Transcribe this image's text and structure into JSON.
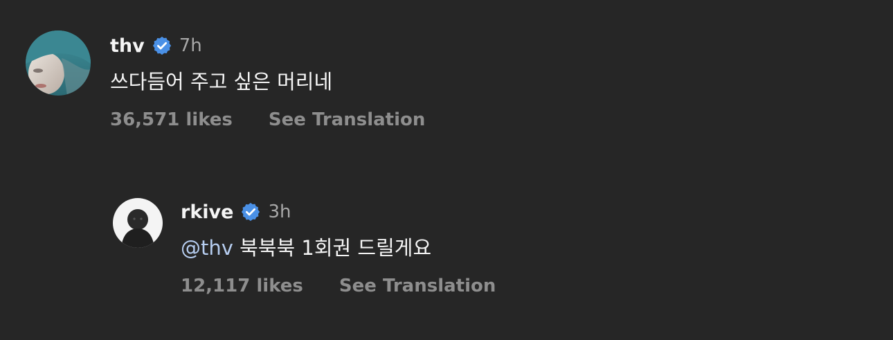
{
  "comments": [
    {
      "username": "thv",
      "time": "7h",
      "text": "쓰다듬어 주고 싶은 머리네",
      "likes": "36,571 likes",
      "translate": "See Translation",
      "verified": true
    },
    {
      "username": "rkive",
      "time": "3h",
      "mention": "@thv",
      "text": "북북북 1회권 드릴게요",
      "likes": "12,117 likes",
      "translate": "See Translation",
      "verified": true
    }
  ],
  "colors": {
    "background": "#262626",
    "verified_badge": "#4a90e6",
    "mention": "#b6cdf0",
    "secondary_text": "#8e8e8e"
  }
}
